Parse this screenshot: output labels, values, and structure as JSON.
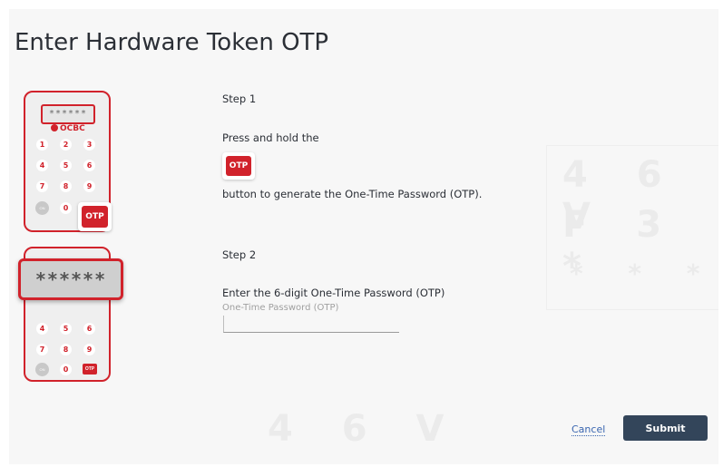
{
  "page": {
    "title": "Enter Hardware Token OTP"
  },
  "token": {
    "screen_digits": "******",
    "magnified_digits": "******",
    "brand": "OCBC",
    "keys_top": [
      "1",
      "2",
      "3",
      "4",
      "5",
      "6",
      "7",
      "8",
      "9"
    ],
    "zero_key": "0",
    "on_key": "ON",
    "otp_button": "OTP"
  },
  "watermark": {
    "top_stars": "* * *",
    "grid_row1": "4 6 V",
    "grid_row2": "F 3 *",
    "grid_row3": "* * *",
    "bottom_row": "4 6 V"
  },
  "step1": {
    "heading": "Step 1",
    "instruction": "Press and hold the",
    "button_label": "OTP",
    "after": "button to generate the One-Time Password (OTP)."
  },
  "step2": {
    "heading": "Step 2",
    "instruction": "Enter the 6-digit One-Time Password (OTP)",
    "field_label": "One-Time Password (OTP)",
    "field_value": ""
  },
  "actions": {
    "cancel": "Cancel",
    "submit": "Submit"
  },
  "colors": {
    "accent_red": "#d1222b",
    "submit_bg": "#33455a",
    "link": "#3a66b0"
  }
}
